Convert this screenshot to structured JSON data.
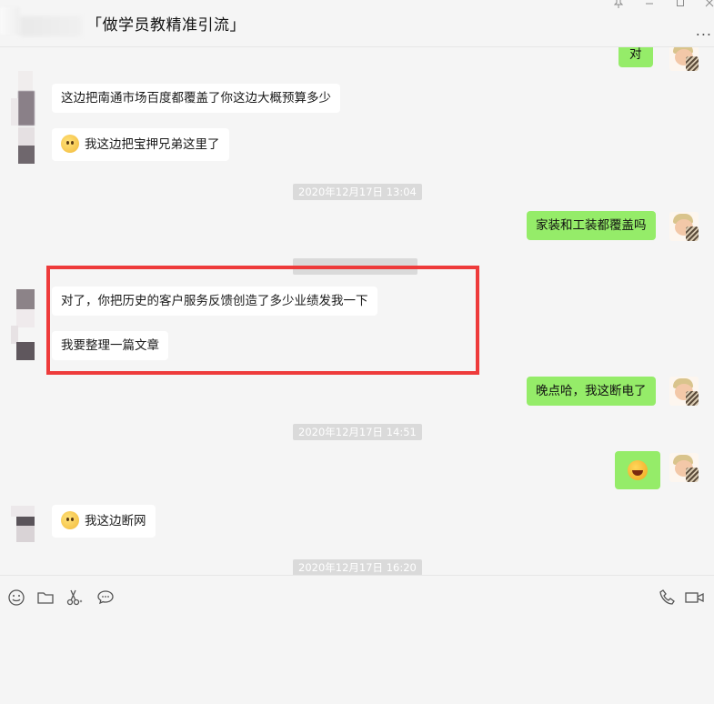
{
  "header": {
    "title": "「做学员教精准引流」",
    "more": "...",
    "window_controls": [
      "pin-icon",
      "minimize-icon",
      "maximize-icon",
      "close-icon"
    ]
  },
  "messages": [
    {
      "side": "right",
      "type": "text",
      "text": "对"
    },
    {
      "side": "left",
      "type": "text",
      "text": "这边把南通市场百度都覆盖了你这边大概预算多少"
    },
    {
      "side": "left",
      "type": "emoji-text",
      "emoji": "thinking-emoji",
      "text": "我这边把宝押兄弟这里了"
    },
    {
      "side": "center",
      "type": "timestamp",
      "text": "2020年12月17日 13:04"
    },
    {
      "side": "right",
      "type": "text",
      "text": "家装和工装都覆盖吗"
    },
    {
      "side": "left",
      "type": "text",
      "text": "对了，你把历史的客户服务反馈创造了多少业绩发我一下"
    },
    {
      "side": "left",
      "type": "text",
      "text": "我要整理一篇文章"
    },
    {
      "side": "right",
      "type": "text",
      "text": "晚点哈，我这断电了"
    },
    {
      "side": "center",
      "type": "timestamp",
      "text": "2020年12月17日 14:51"
    },
    {
      "side": "right",
      "type": "emoji",
      "emoji": "laughing-emoji"
    },
    {
      "side": "left",
      "type": "emoji-text",
      "emoji": "dizzy-emoji",
      "text": "我这边断网"
    },
    {
      "side": "center",
      "type": "timestamp",
      "text": "2020年12月17日 16:20"
    }
  ],
  "toolbar": {
    "left_tools": [
      "emoji-icon",
      "folder-icon",
      "scissors-icon",
      "chat-bubble-icon"
    ],
    "right_tools": [
      "phone-icon",
      "video-icon"
    ]
  },
  "colors": {
    "background": "#f5f5f5",
    "bubble_self": "#95ec69",
    "bubble_other": "#ffffff",
    "highlight_box": "#ee3b3b",
    "timestamp_bg": "#dadada"
  }
}
